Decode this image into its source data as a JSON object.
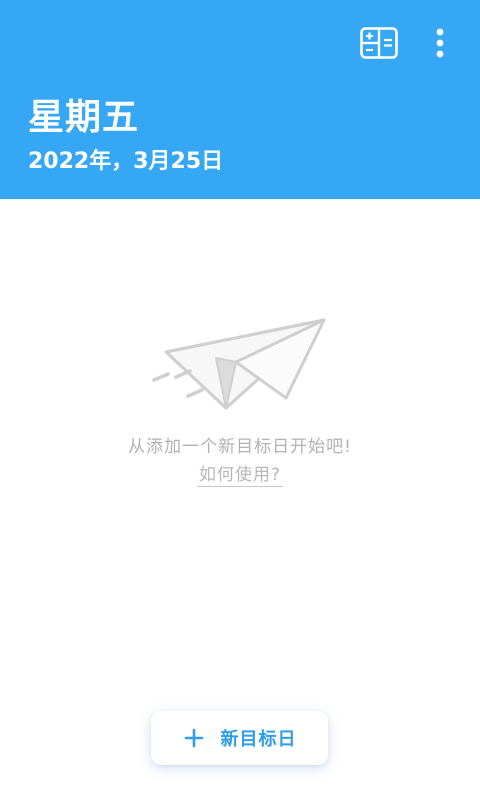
{
  "header": {
    "weekday": "星期五",
    "date": "2022年，3月25日",
    "background_color": "#35a7f5",
    "actions": [
      {
        "icon": "calculator-icon"
      },
      {
        "icon": "more-vert-icon"
      }
    ]
  },
  "empty_state": {
    "illustration_icon": "paper-plane-icon",
    "message": "从添加一个新目标日开始吧!",
    "help_link": "如何使用?"
  },
  "add_button": {
    "icon": "plus-icon",
    "label": "新目标日",
    "accent_color": "#2f9ee6"
  }
}
